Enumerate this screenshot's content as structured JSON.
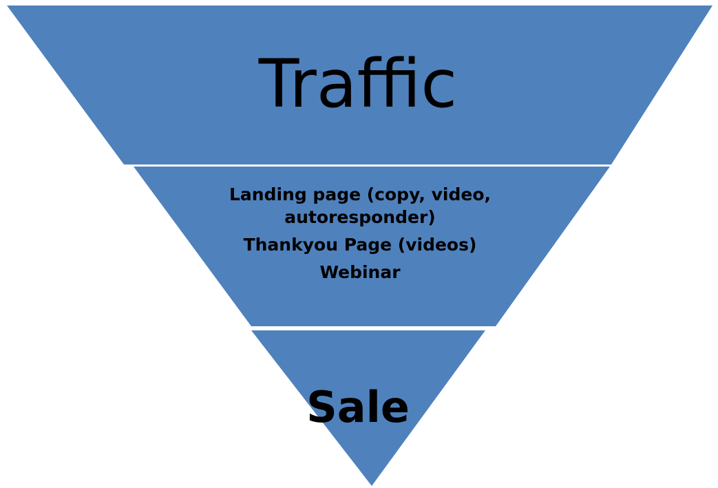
{
  "diagram": {
    "type": "funnel",
    "fill_color": "#4f81bd",
    "divider_color": "#ffffff",
    "stages": [
      {
        "label": "Traffic"
      },
      {
        "lines": [
          "Landing page (copy, video,",
          "autoresponder)",
          "Thankyou Page (videos)",
          "Webinar"
        ]
      },
      {
        "label": "Sale"
      }
    ]
  }
}
